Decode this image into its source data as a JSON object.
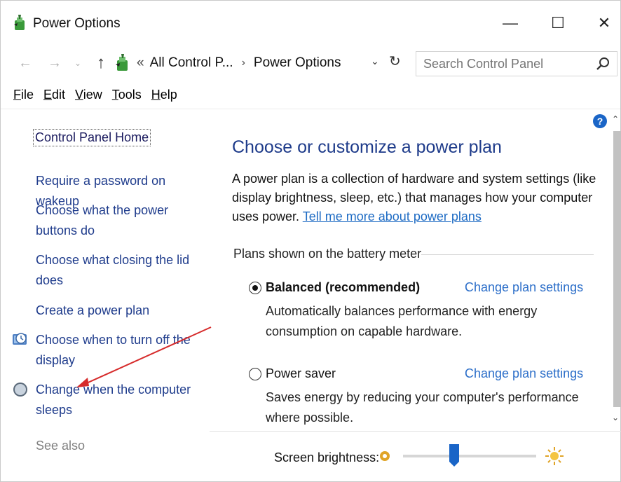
{
  "window": {
    "title": "Power Options",
    "minimize_glyph": "—",
    "maximize_glyph": "☐",
    "close_glyph": "✕"
  },
  "address_bar": {
    "back_glyph": "←",
    "forward_glyph": "→",
    "history_glyph": "⌄",
    "up_glyph": "↑",
    "separator": "«",
    "crumbs": [
      "All Control P...",
      "Power Options"
    ],
    "crumb_arrow": "›",
    "dropdown_glyph": "⌄",
    "refresh_glyph": "↻"
  },
  "search": {
    "placeholder": "Search Control Panel"
  },
  "menu": [
    {
      "key": "F",
      "rest": "ile"
    },
    {
      "key": "E",
      "rest": "dit"
    },
    {
      "key": "V",
      "rest": "iew"
    },
    {
      "key": "T",
      "rest": "ools"
    },
    {
      "key": "H",
      "rest": "elp"
    }
  ],
  "left_pane": {
    "home": "Control Panel Home",
    "tasks": [
      {
        "line1": "Require a password on wakeup",
        "line2": ""
      },
      {
        "line1": "Choose what the power",
        "line2": "buttons do"
      },
      {
        "line1": "Choose what closing the lid",
        "line2": "does"
      },
      {
        "line1": "Create a power plan",
        "line2": ""
      },
      {
        "line1": "Choose when to turn off the",
        "line2": "display",
        "icon": "display-clock-icon"
      },
      {
        "line1": "Change when the computer",
        "line2": "sleeps",
        "icon": "moon-sleep-icon"
      }
    ],
    "see_also": "See also"
  },
  "main": {
    "title": "Choose or customize a power plan",
    "description": "A power plan is a collection of hardware and system settings (like display brightness, sleep, etc.) that manages how your computer uses power.",
    "learn_more": "Tell me more about power plans",
    "group_label": "Plans shown on the battery meter",
    "plans": [
      {
        "name": "Balanced (recommended)",
        "selected": true,
        "change_label": "Change plan settings",
        "description": "Automatically balances performance with energy consumption on capable hardware."
      },
      {
        "name": "Power saver",
        "selected": false,
        "change_label": "Change plan settings",
        "description": "Saves energy by reducing your computer's performance where possible."
      }
    ]
  },
  "brightness": {
    "label": "Screen brightness:",
    "level_percent": 35
  },
  "colors": {
    "link": "#1f3c8c",
    "title": "#1e3b8a",
    "accent": "#2d6fc9",
    "help": "#1a65c7",
    "annotation_arrow": "#d62b2b"
  }
}
